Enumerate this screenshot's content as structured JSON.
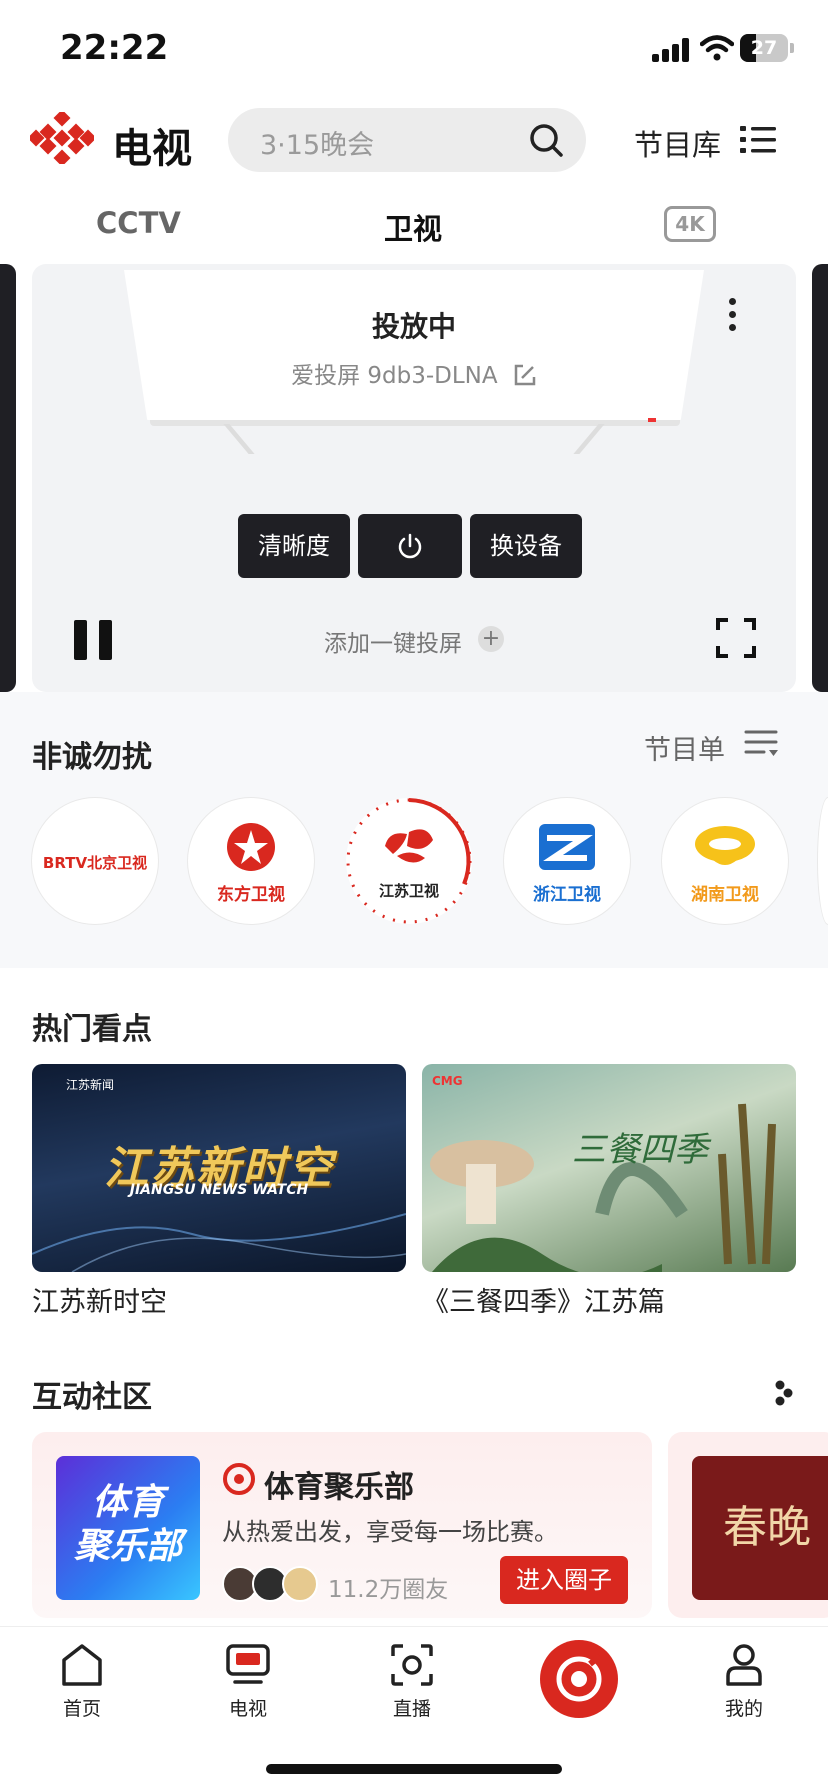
{
  "status_bar": {
    "time": "22:22",
    "battery": "27"
  },
  "header": {
    "logo_text": "电视",
    "search_placeholder": "3·15晚会",
    "library_label": "节目库"
  },
  "tabs": [
    {
      "label": "CCTV"
    },
    {
      "label": "卫视"
    },
    {
      "label": "4K"
    }
  ],
  "cast": {
    "status": "投放中",
    "device": "爱投屏 9db3-DLNA",
    "buttons": {
      "clarity": "清晰度",
      "switch_device": "换设备"
    },
    "add_one_click": "添加一键投屏"
  },
  "now_playing": {
    "title": "非诚勿扰",
    "schedule_label": "节目单"
  },
  "channels": [
    {
      "name": "BRTV北京卫视",
      "color": "#d9281f"
    },
    {
      "name": "东方卫视",
      "color": "#d9281f"
    },
    {
      "name": "江苏卫视",
      "color": "#d9281f",
      "selected": true
    },
    {
      "name": "浙江卫视",
      "color": "#1a6fd1"
    },
    {
      "name": "湖南卫视",
      "color": "#f29a1c"
    }
  ],
  "hot": {
    "title": "热门看点",
    "items": [
      {
        "caption": "江苏新时空",
        "brand": "江苏新闻",
        "headline": "江苏新时空",
        "subtitle": "JIANGSU NEWS WATCH"
      },
      {
        "caption": "《三餐四季》江苏篇",
        "brand": "CMG",
        "headline": "三餐四季"
      }
    ]
  },
  "community": {
    "title": "互动社区",
    "club": {
      "image_text": [
        "体育",
        "聚乐部"
      ],
      "name": "体育聚乐部",
      "desc": "从热爱出发，享受每一场比赛。",
      "members": "11.2万圈友",
      "join": "进入圈子"
    },
    "next_card": "春晚"
  },
  "bottom_nav": [
    {
      "label": "首页"
    },
    {
      "label": "电视"
    },
    {
      "label": "直播"
    },
    {
      "label": ""
    },
    {
      "label": "我的"
    }
  ],
  "colors": {
    "accent": "#d9281f",
    "dark_button": "#1f1f24"
  }
}
